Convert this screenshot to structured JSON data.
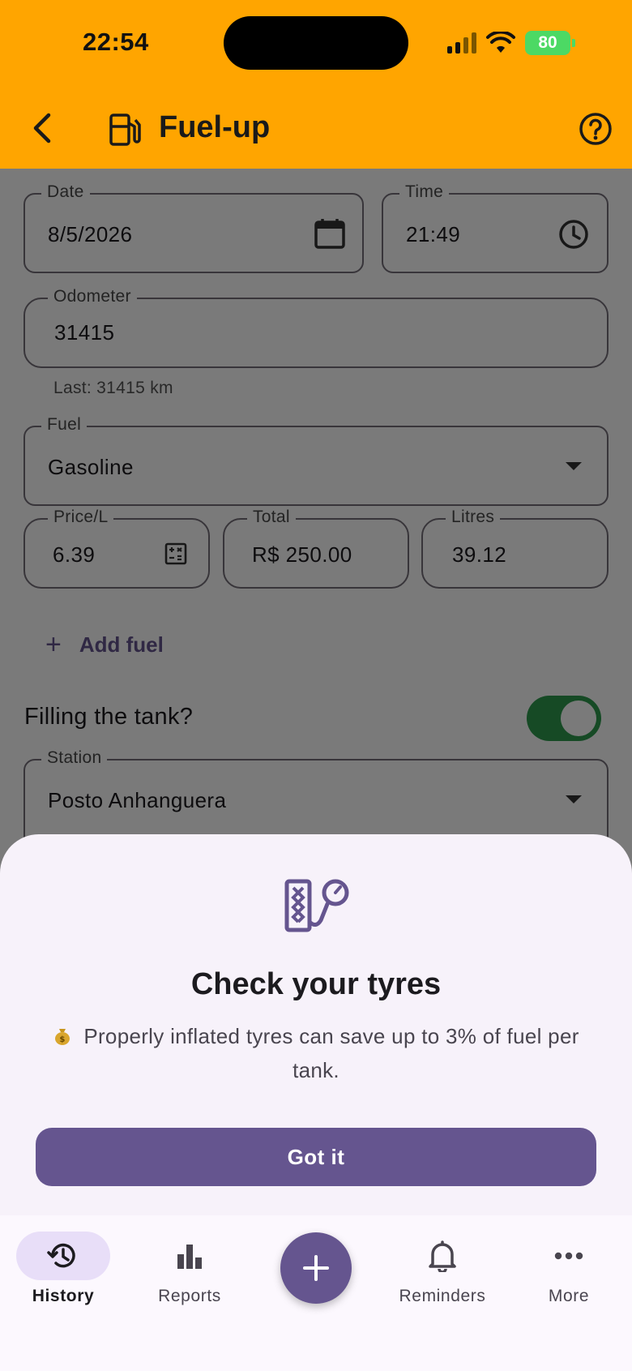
{
  "status_bar": {
    "time": "22:54",
    "battery": "80"
  },
  "app_bar": {
    "title": "Fuel-up"
  },
  "form": {
    "date": {
      "label": "Date",
      "value": "8/5/2026"
    },
    "time": {
      "label": "Time",
      "value": "21:49"
    },
    "odometer": {
      "label": "Odometer",
      "value": "31415",
      "helper": "Last: 31415 km"
    },
    "fuel": {
      "label": "Fuel",
      "value": "Gasoline"
    },
    "price": {
      "label": "Price/L",
      "value": "6.39"
    },
    "total": {
      "label": "Total",
      "value": "R$ 250.00"
    },
    "litres": {
      "label": "Litres",
      "value": "39.12"
    },
    "add_fuel": "Add fuel",
    "filling_tank": {
      "label": "Filling the tank?",
      "checked": true
    },
    "station": {
      "label": "Station",
      "value": "Posto Anhanguera"
    }
  },
  "sheet": {
    "title": "Check your tyres",
    "body": "Properly inflated tyres can save up to 3% of fuel per tank.",
    "button": "Got it"
  },
  "nav": {
    "items": [
      {
        "label": "History",
        "icon": "history-icon",
        "active": true
      },
      {
        "label": "Reports",
        "icon": "bar-chart-icon",
        "active": false
      },
      {
        "label": "Reminders",
        "icon": "bell-icon",
        "active": false
      },
      {
        "label": "More",
        "icon": "more-horiz-icon",
        "active": false
      }
    ],
    "fab_icon": "plus-icon"
  },
  "colors": {
    "app_bar": "#ffa500",
    "primary": "#65558f",
    "switch_on": "#2e9b4e",
    "sheet_bg": "#f7f2fa"
  }
}
